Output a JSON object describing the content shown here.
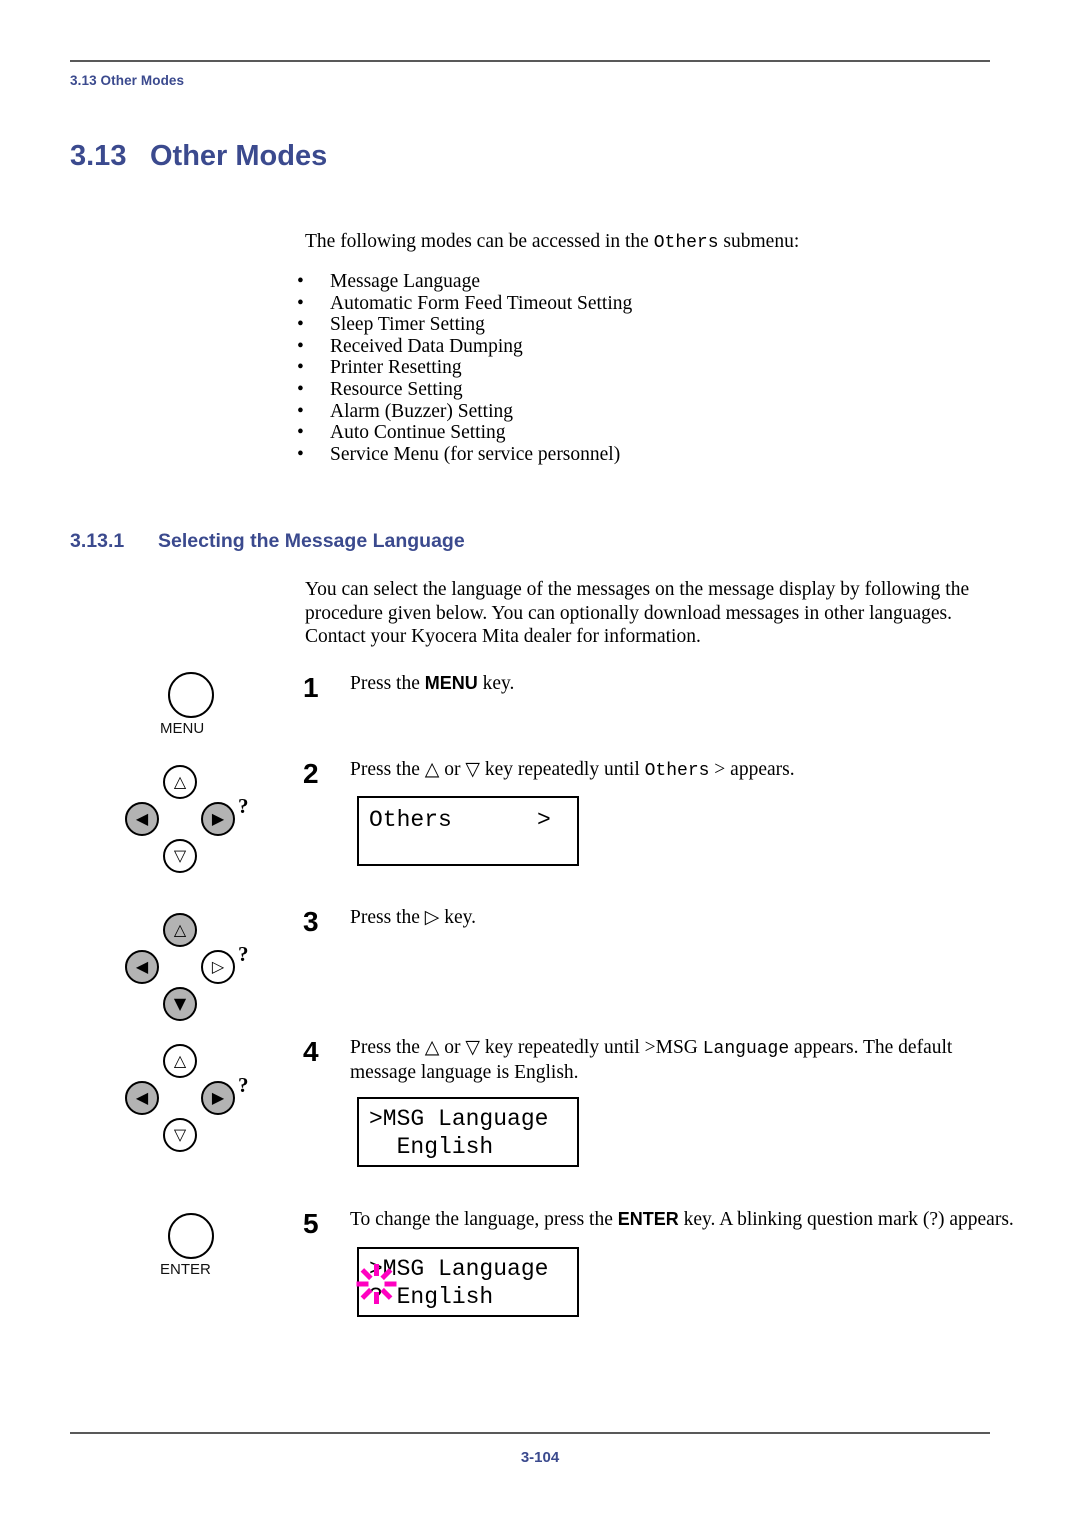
{
  "header": {
    "running_head": "3.13 Other Modes"
  },
  "section": {
    "number": "3.13",
    "title": "Other Modes"
  },
  "intro": {
    "before_mono": "The following modes can be accessed in the ",
    "mono": "Others",
    "after_mono": " submenu:"
  },
  "bullet_marker": "•",
  "bullets": [
    "Message Language",
    "Automatic Form Feed Timeout Setting",
    "Sleep Timer Setting",
    "Received Data Dumping",
    "Printer Resetting",
    "Resource Setting",
    "Alarm (Buzzer) Setting",
    "Auto Continue Setting",
    "Service Menu (for service personnel)"
  ],
  "subsection": {
    "number": "3.13.1",
    "title": "Selecting the Message Language"
  },
  "paragraph": "You can select the language of the messages on the message display by following the procedure given below.  You can optionally download messages in other languages. Contact your Kyocera Mita dealer for information.",
  "steps": [
    {
      "number": "1",
      "text_parts": [
        "Press the ",
        "MENU",
        " key."
      ],
      "key_icon": "menu-key",
      "key_label": "MENU"
    },
    {
      "number": "2",
      "text_parts": [
        "Press the ",
        "△",
        " or ",
        "▽",
        " key repeatedly until ",
        "Others",
        "  > appears."
      ],
      "key_icon": "arrow-key-cluster",
      "lcd": {
        "line1_left": "Others",
        "line1_right": ">",
        "line2": ""
      }
    },
    {
      "number": "3",
      "text_parts": [
        "Press the ",
        "▷",
        " key."
      ],
      "key_icon": "arrow-key-cluster"
    },
    {
      "number": "4",
      "text_parts": [
        "Press the ",
        "△",
        " or ",
        "▽",
        " key repeatedly until >MSG ",
        "Language",
        " appears. The default message language is English."
      ],
      "key_icon": "arrow-key-cluster",
      "lcd": {
        "line1": ">MSG Language",
        "line2": "  English"
      }
    },
    {
      "number": "5",
      "text_parts": [
        "To change the language, press the ",
        "ENTER",
        " key. A blinking question mark  (?) appears."
      ],
      "key_icon": "enter-key",
      "key_label": "ENTER",
      "lcd": {
        "line1": ">MSG Language",
        "line2": "? English",
        "blink": true
      }
    }
  ],
  "labels": {
    "step1_text_a": "Press the ",
    "step1_key": "MENU",
    "step1_text_b": " key.",
    "step2_text_a": "Press the ",
    "step2_up": "△",
    "step2_text_b": " or ",
    "step2_down": "▽",
    "step2_text_c": " key repeatedly until ",
    "step2_mono": "Others",
    "step2_text_d": "  > appears.",
    "step3_text_a": "Press the ",
    "step3_right": "▷",
    "step3_text_b": " key.",
    "step4_text_a": "Press the ",
    "step4_up": "△",
    "step4_text_b": " or ",
    "step4_down": "▽",
    "step4_text_c": " key repeatedly until >MSG ",
    "step4_mono": "Language",
    "step4_text_d": " appears. The default message language is English.",
    "step5_text_a": "To change the language, press the ",
    "step5_key": "ENTER",
    "step5_text_b": " key. A blinking question mark  (?) appears.",
    "menu_key_label": "MENU",
    "enter_key_label": "ENTER",
    "help_mark": "?",
    "up_glyph": "△",
    "down_glyph": "▽",
    "left_glyph": "◁",
    "right_glyph": "▷",
    "up_glyph_filled": "△",
    "left_glyph_filled": "◀",
    "right_glyph_filled": "▶",
    "down_glyph_filled": "▼"
  },
  "lcd2": {
    "left": "Others",
    "right": ">"
  },
  "lcd4": {
    "line1": ">MSG Language",
    "line2": "  English"
  },
  "lcd5": {
    "line1": ">MSG Language",
    "line2": "? English"
  },
  "footer": {
    "page_number": "3-104"
  },
  "colors": {
    "heading": "#3b4a8e",
    "rule": "#595959",
    "key_gray": "#b3b3b3",
    "blink": "#ff00c0"
  }
}
